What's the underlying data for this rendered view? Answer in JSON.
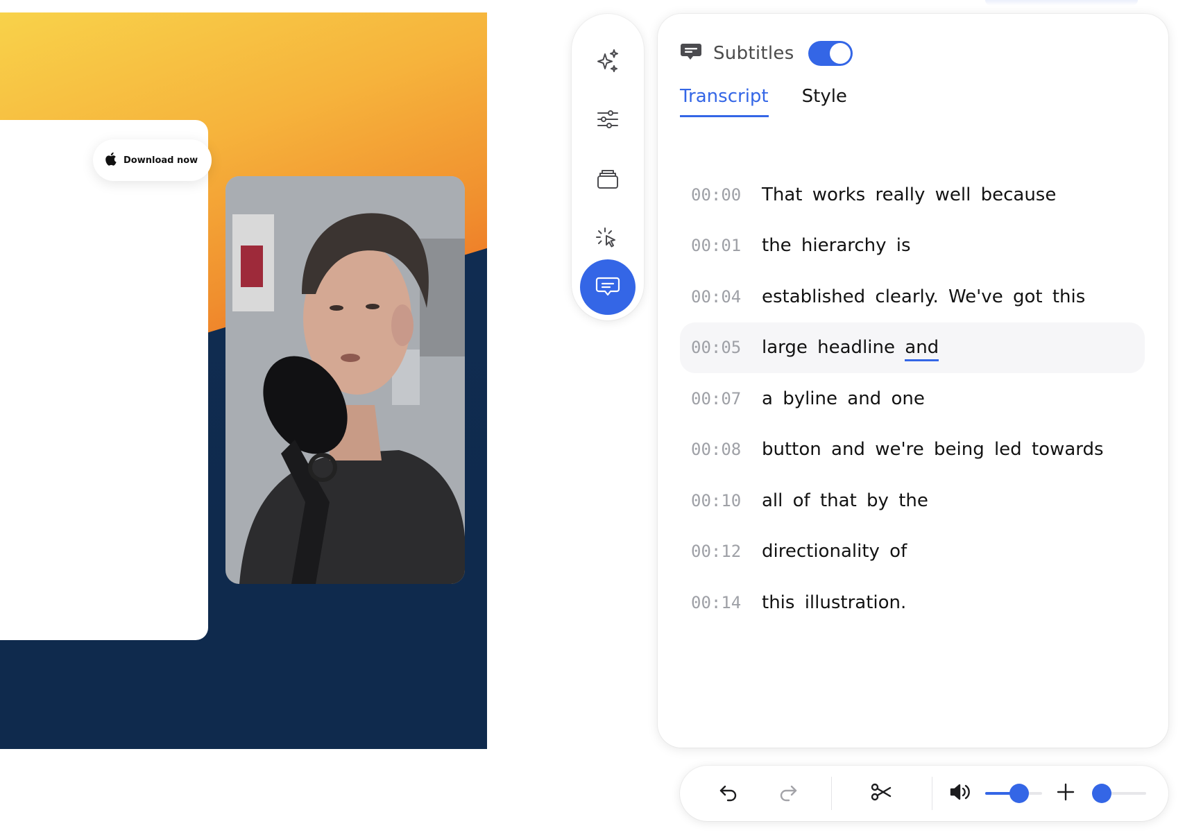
{
  "canvas": {
    "download_label": "Download now",
    "colors": {
      "yellow": "#f8d24a",
      "orange": "#ee7a28",
      "navy": "#0f2a4d"
    }
  },
  "rail": {
    "items": [
      {
        "icon": "sparkles-icon",
        "active": false
      },
      {
        "icon": "sliders-icon",
        "active": false
      },
      {
        "icon": "layers-icon",
        "active": false
      },
      {
        "icon": "cursor-click-icon",
        "active": false
      },
      {
        "icon": "subtitles-icon",
        "active": true
      }
    ],
    "accent": "#3466e6"
  },
  "panel": {
    "title": "Subtitles",
    "toggle_on": true,
    "tabs": [
      {
        "label": "Transcript",
        "active": true
      },
      {
        "label": "Style",
        "active": false
      }
    ],
    "rows": [
      {
        "time": "00:00",
        "text": "That works really well because"
      },
      {
        "time": "00:01",
        "text": "the hierarchy is"
      },
      {
        "time": "00:04",
        "text": "established clearly. We've got this"
      },
      {
        "time": "00:05",
        "text_before": "large headline",
        "underlined_word": "and",
        "highlighted": true
      },
      {
        "time": "00:07",
        "text": "a byline and one"
      },
      {
        "time": "00:08",
        "text": "button and we're being led towards"
      },
      {
        "time": "00:10",
        "text": "all of that by the"
      },
      {
        "time": "00:12",
        "text": "directionality of"
      },
      {
        "time": "00:14",
        "text": "this illustration."
      }
    ]
  },
  "toolbar": {
    "icons": [
      "undo-icon",
      "redo-icon",
      "scissors-icon",
      "volume-icon",
      "zoom-in-icon"
    ],
    "volume_level": 0.6,
    "zoom_level": 0.18
  }
}
